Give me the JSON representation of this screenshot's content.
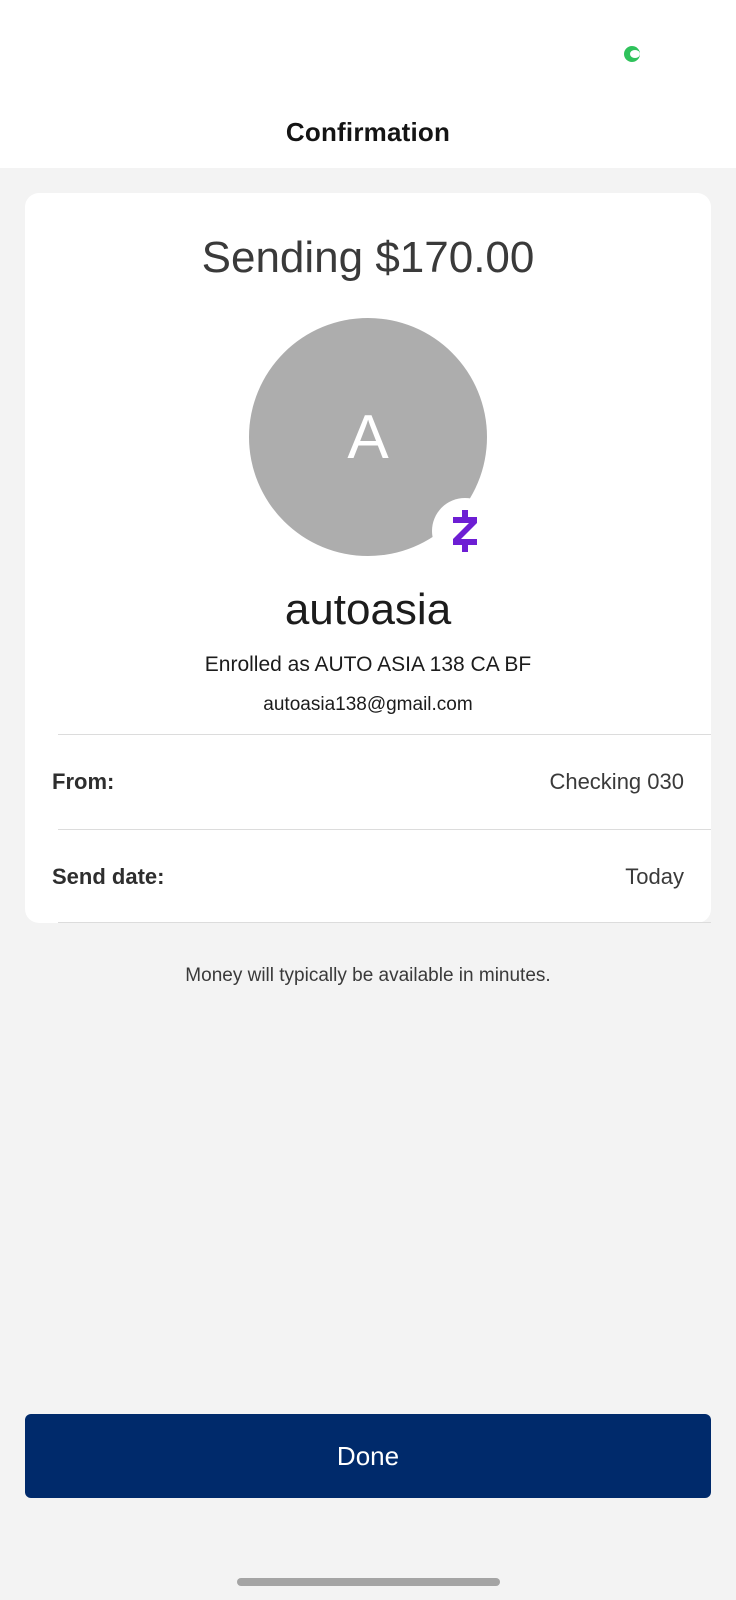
{
  "header": {
    "title": "Confirmation"
  },
  "summary": {
    "sending_text": "Sending $170.00",
    "avatar_initial": "A",
    "recipient_name": "autoasia",
    "enrolled_text": "Enrolled as AUTO ASIA 138 CA BF",
    "email": "autoasia138@gmail.com"
  },
  "details": {
    "from_label": "From:",
    "from_value": "Checking 030",
    "send_date_label": "Send date:",
    "send_date_value": "Today"
  },
  "note": "Money will typically be available in minutes.",
  "actions": {
    "done_label": "Done"
  },
  "icons": {
    "badge": "zelle-icon",
    "status": "status-indicator-icon"
  },
  "colors": {
    "primary_button": "#002a6b",
    "zelle_purple": "#6d1ed4",
    "avatar_gray": "#adadad",
    "status_green": "#2fc25b"
  }
}
